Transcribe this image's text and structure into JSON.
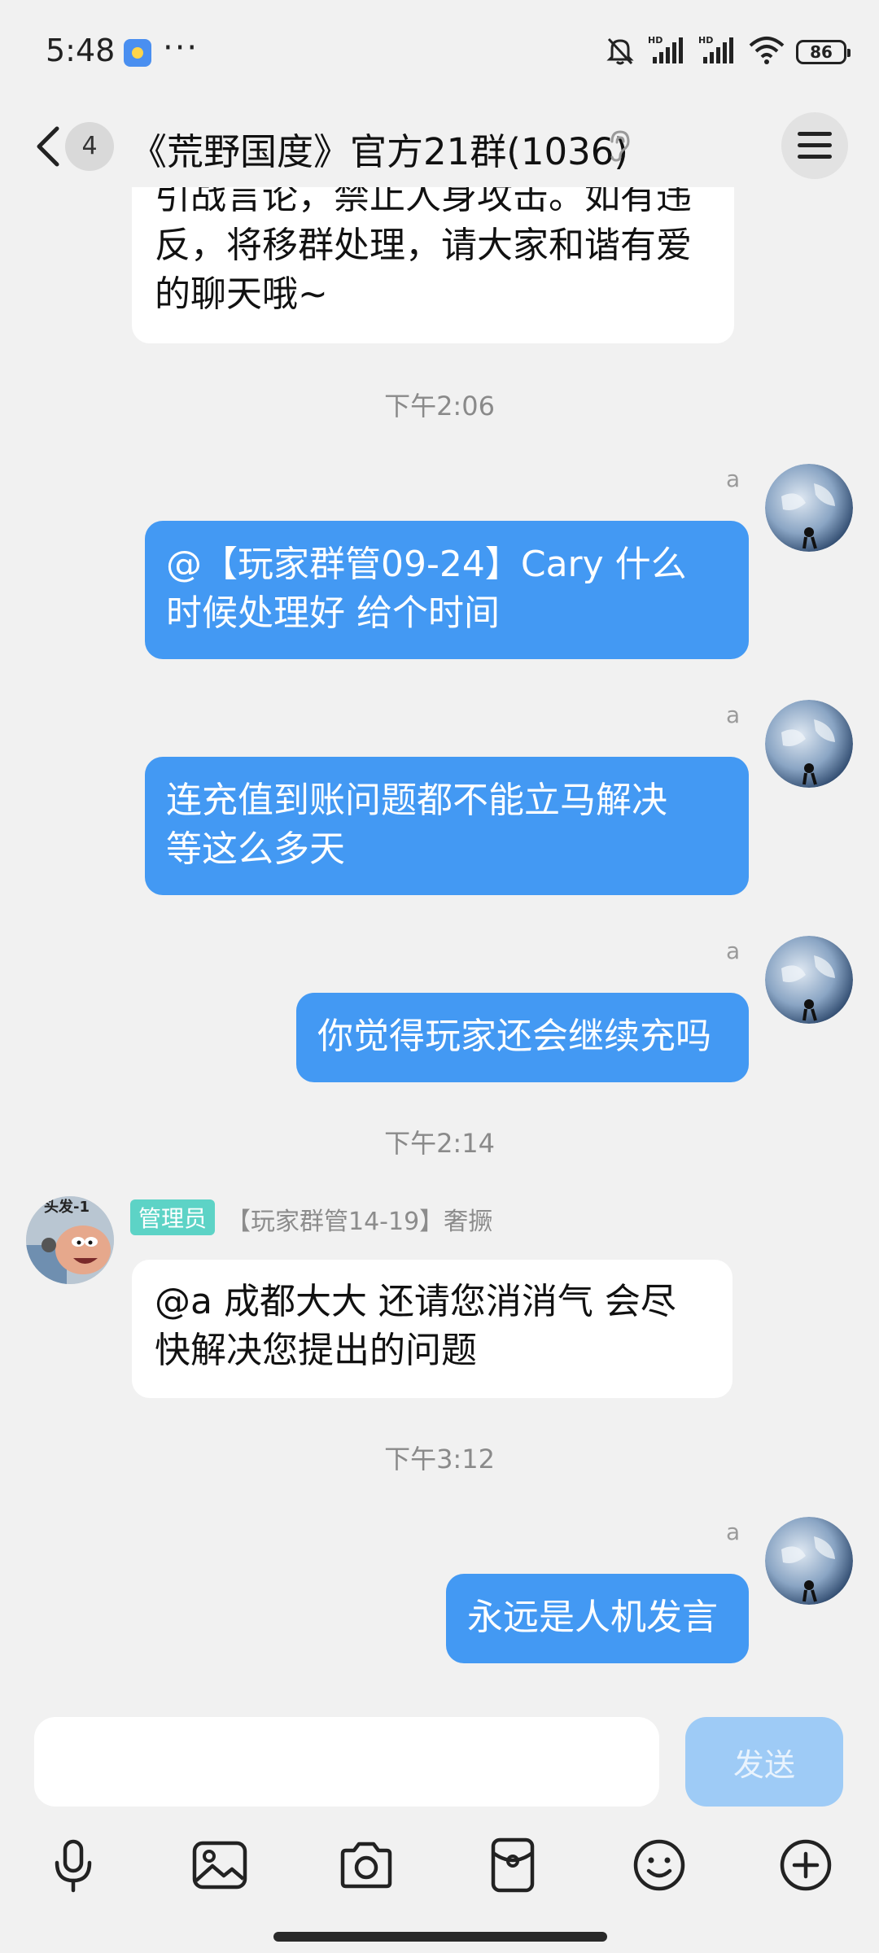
{
  "status_bar": {
    "time": "5:48",
    "dots": "···",
    "signal_label_1": "HD",
    "signal_label_2": "HD",
    "battery": "86"
  },
  "header": {
    "unread_count": "4",
    "title": "《荒野国度》官方21群(1036)"
  },
  "messages": {
    "m1_text_l1": "引战言论，禁止人身攻击。如有违",
    "m1_text_l2": "反，将移群处理，请大家和谐有爱",
    "m1_text_l3": "的聊天哦~",
    "ts1": "下午2:06",
    "m2_sender": "a",
    "m2_text_l1": "@【玩家群管09-24】Cary 什么",
    "m2_text_l2": "时候处理好  给个时间",
    "m3_sender": "a",
    "m3_text_l1": "连充值到账问题都不能立马解决",
    "m3_text_l2": "等这么多天",
    "m4_sender": "a",
    "m4_text": "你觉得玩家还会继续充吗",
    "ts2": "下午2:14",
    "m5_role": "管理员",
    "m5_sender": "【玩家群管14-19】奢撅",
    "m5_avatar_text": "头发-1",
    "m5_text_l1": "@a 成都大大 还请您消消气 会尽",
    "m5_text_l2": "快解决您提出的问题",
    "ts3": "下午3:12",
    "m6_sender": "a",
    "m6_text": "永远是人机发言"
  },
  "input": {
    "value": "",
    "send_label": "发送"
  },
  "toolbar": [
    "voice-icon",
    "image-icon",
    "camera-icon",
    "red-packet-icon",
    "emoji-icon",
    "plus-icon"
  ],
  "colors": {
    "outgoing_bubble": "#4399f3",
    "incoming_bubble": "#ffffff",
    "background": "#f1f1f1",
    "admin_badge": "#5dd3c6",
    "send_disabled": "#9ecbf6"
  }
}
